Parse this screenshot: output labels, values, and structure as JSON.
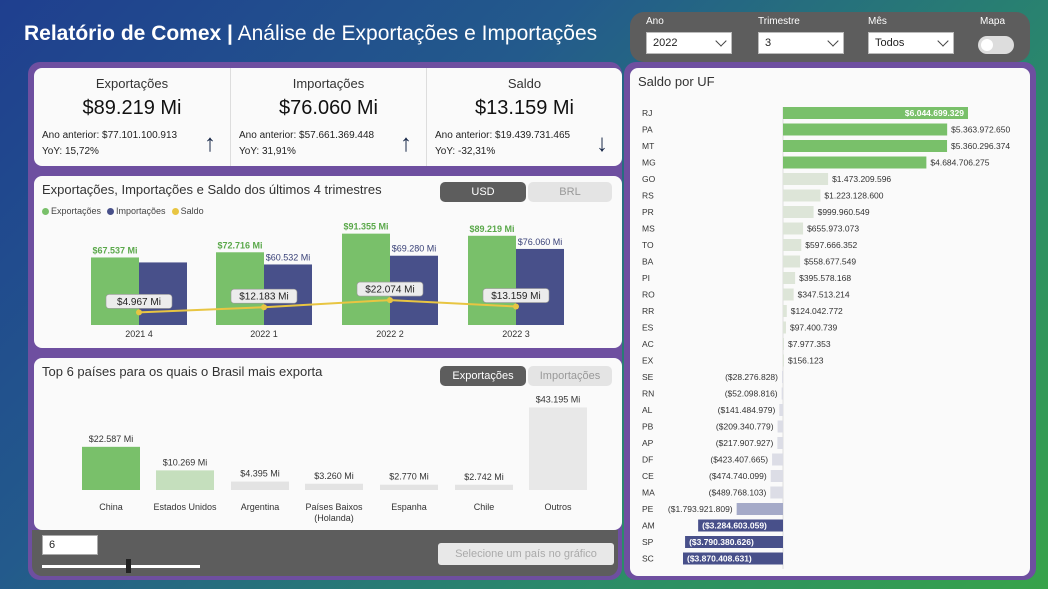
{
  "header": {
    "title_bold": "Relatório de Comex |",
    "title_sub": "Análise de Exportações e Importações"
  },
  "filters": {
    "ano": {
      "label": "Ano",
      "value": "2022"
    },
    "trimestre": {
      "label": "Trimestre",
      "value": "3"
    },
    "mes": {
      "label": "Mês",
      "value": "Todos"
    },
    "mapa": {
      "label": "Mapa",
      "value": "off"
    }
  },
  "kpis": [
    {
      "label": "Exportações",
      "value": "$89.219 Mi",
      "previous": "Ano anterior: $77.101.100.913",
      "yoy": "YoY: 15,72%",
      "arrow": "↑"
    },
    {
      "label": "Importações",
      "value": "$76.060 Mi",
      "previous": "Ano anterior: $57.661.369.448",
      "yoy": "YoY: 31,91%",
      "arrow": "↑"
    },
    {
      "label": "Saldo",
      "value": "$13.159 Mi",
      "previous": "Ano anterior: $19.439.731.465",
      "yoy": "YoY: -32,31%",
      "arrow": "↓"
    }
  ],
  "quarters": {
    "title": "Exportações, Importações e Saldo dos últimos 4 trimestres",
    "toggle": {
      "usd": "USD",
      "brl": "BRL"
    },
    "legend": {
      "exp": "Exportações",
      "imp": "Importações",
      "saldo": "Saldo"
    }
  },
  "countries": {
    "title": "Top 6 países para os quais o Brasil mais exporta",
    "toggle": {
      "exp": "Exportações",
      "imp": "Importações"
    }
  },
  "controls": {
    "topn_value": "6",
    "select_button": "Selecione um país no gráfico"
  },
  "uf": {
    "title": "Saldo por UF"
  },
  "colors": {
    "export": "#79c06a",
    "import": "#48508a",
    "saldo": "#e8c542"
  },
  "chart_data": [
    {
      "type": "bar",
      "title": "Exportações, Importações e Saldo dos últimos 4 trimestres",
      "categories": [
        "2021 4",
        "2022 1",
        "2022 2",
        "2022 3"
      ],
      "series": [
        {
          "name": "Exportações",
          "values": [
            67537,
            72716,
            91355,
            89219
          ],
          "labels": [
            "$67.537 Mi",
            "$72.716 Mi",
            "$91.355 Mi",
            "$89.219 Mi"
          ]
        },
        {
          "name": "Importações",
          "values": [
            62570,
            60532,
            69280,
            76060
          ],
          "labels": [
            "",
            "$60.532 Mi",
            "$69.280 Mi",
            "$76.060 Mi"
          ]
        },
        {
          "name": "Saldo",
          "values": [
            4967,
            12183,
            22074,
            13159
          ],
          "labels": [
            "$4.967 Mi",
            "$12.183 Mi",
            "$22.074 Mi",
            "$13.159 Mi"
          ]
        }
      ]
    },
    {
      "type": "bar",
      "title": "Top 6 países para os quais o Brasil mais exporta",
      "categories": [
        "China",
        "Estados Unidos",
        "Argentina",
        "Países Baixos (Holanda)",
        "Espanha",
        "Chile",
        "Outros"
      ],
      "values": [
        22587,
        10269,
        4395,
        3260,
        2770,
        2742,
        43195
      ],
      "labels": [
        "$22.587 Mi",
        "$10.269 Mi",
        "$4.395 Mi",
        "$3.260 Mi",
        "$2.770 Mi",
        "$2.742 Mi",
        "$43.195 Mi"
      ]
    },
    {
      "type": "bar",
      "title": "Saldo por UF",
      "categories": [
        "RJ",
        "PA",
        "MT",
        "MG",
        "GO",
        "RS",
        "PR",
        "MS",
        "TO",
        "BA",
        "PI",
        "RO",
        "RR",
        "ES",
        "AC",
        "EX",
        "SE",
        "RN",
        "AL",
        "PB",
        "AP",
        "DF",
        "CE",
        "MA",
        "PE",
        "AM",
        "SP",
        "SC"
      ],
      "values": [
        6044699329,
        5363972650,
        5360296374,
        4684706275,
        1473209596,
        1223128600,
        999960549,
        655973073,
        597666352,
        558677549,
        395578168,
        347513214,
        124042772,
        97400739,
        7977353,
        156123,
        -28276828,
        -52098816,
        -141484979,
        -209340779,
        -217907927,
        -423407665,
        -474740099,
        -489768103,
        -1793921809,
        -3284603059,
        -3790380626,
        -3870408631
      ],
      "labels": [
        "$6.044.699.329",
        "$5.363.972.650",
        "$5.360.296.374",
        "$4.684.706.275",
        "$1.473.209.596",
        "$1.223.128.600",
        "$999.960.549",
        "$655.973.073",
        "$597.666.352",
        "$558.677.549",
        "$395.578.168",
        "$347.513.214",
        "$124.042.772",
        "$97.400.739",
        "$7.977.353",
        "$156.123",
        "($28.276.828)",
        "($52.098.816)",
        "($141.484.979)",
        "($209.340.779)",
        "($217.907.927)",
        "($423.407.665)",
        "($474.740.099)",
        "($489.768.103)",
        "($1.793.921.809)",
        "($3.284.603.059)",
        "($3.790.380.626)",
        "($3.870.408.631)"
      ]
    }
  ]
}
